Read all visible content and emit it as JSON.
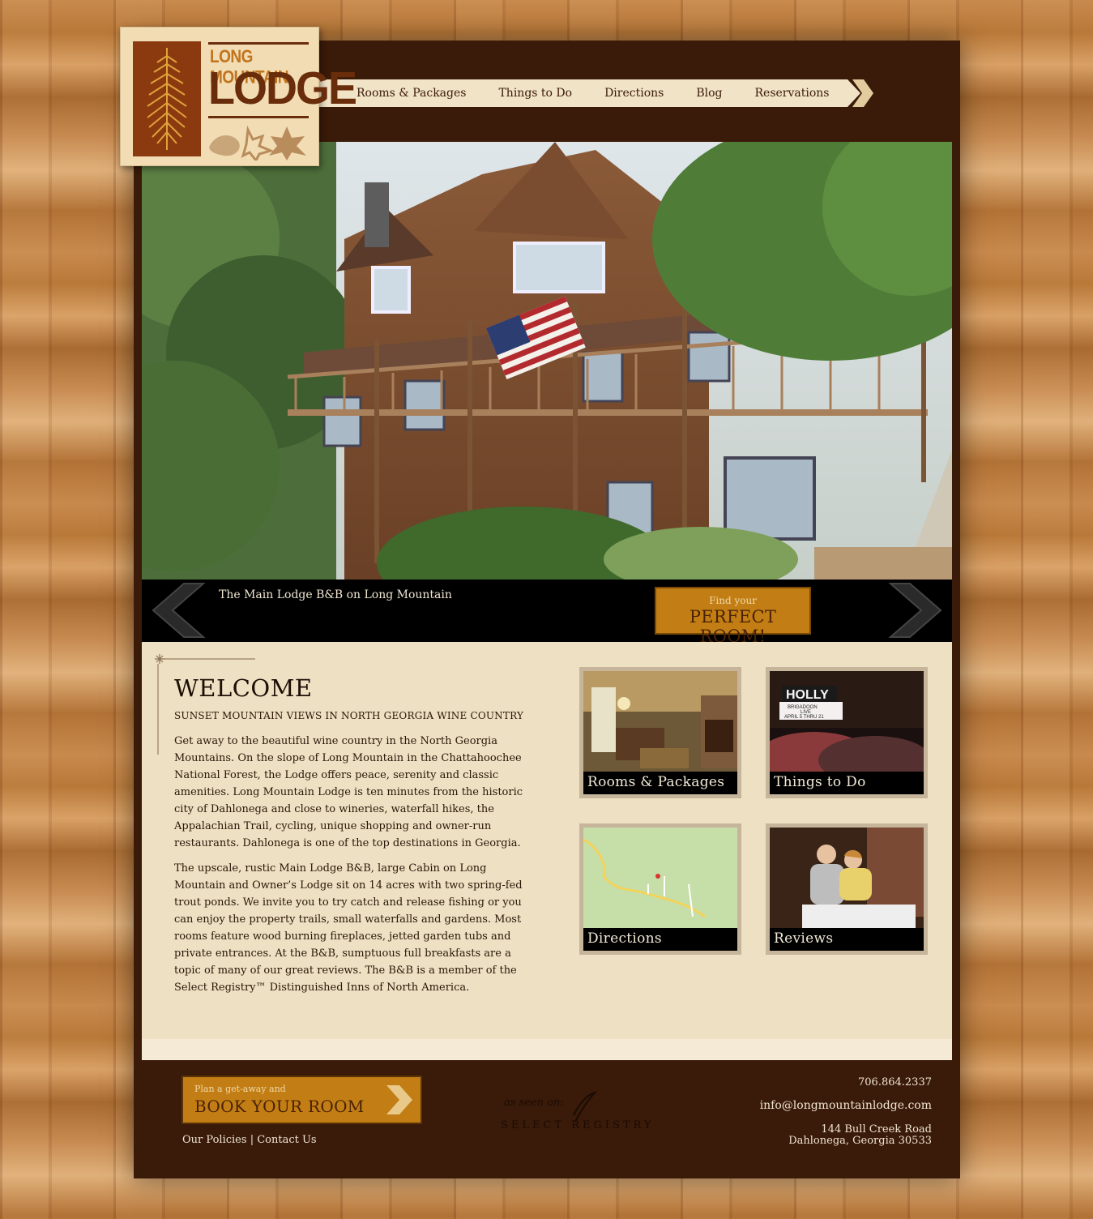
{
  "logo": {
    "line1": "LONG MOUNTAIN",
    "line2": "LODGE"
  },
  "nav": {
    "items": [
      {
        "label": "Rooms & Packages"
      },
      {
        "label": "Things to Do"
      },
      {
        "label": "Directions"
      },
      {
        "label": "Blog"
      },
      {
        "label": "Reservations"
      }
    ]
  },
  "hero": {
    "caption": "The Main Lodge B&B on Long Mountain",
    "find_small": "Find your",
    "find_big": "PERFECT ROOM!"
  },
  "welcome": {
    "title": "WELCOME",
    "subtitle": "SUNSET MOUNTAIN VIEWS IN NORTH GEORGIA WINE COUNTRY",
    "para1": "Get away to the beautiful wine country in the North Georgia Mountains. On the slope of Long Mountain in the Chattahoochee National Forest, the Lodge offers peace, serenity and classic amenities. Long Mountain Lodge is ten minutes from the historic city of Dahlonega and close to wineries, waterfall hikes, the Appalachian Trail, cycling, unique shopping and owner-run restaurants. Dahlonega is one of the top destinations in Georgia.",
    "para2": "The upscale, rustic Main Lodge B&B, large Cabin on Long Mountain and Owner’s Lodge sit on 14 acres with two spring-fed trout ponds. We invite you to try catch and release fishing or you can enjoy the property trails, small waterfalls and gardens. Most rooms feature wood burning fireplaces, jetted garden tubs and private entrances.  At the B&B, sumptuous full breakfasts are a topic of many of our great reviews. The B&B is a member of the Select Registry™ Distinguished Inns of North America."
  },
  "tiles": {
    "rooms": "Rooms & Packages",
    "things": "Things to Do",
    "directions": "Directions",
    "reviews": "Reviews",
    "theater_sign": "HOLLY",
    "theater_marquee1": "BRIGADOON",
    "theater_marquee2": "LIVE",
    "theater_marquee3": "APRIL 5 THRU 21"
  },
  "footer": {
    "book_small": "Plan a get-away and",
    "book_big": "BOOK YOUR ROOM",
    "policies": "Our Policies",
    "separator": "|",
    "contact_us": "Contact Us",
    "seen_on": "as seen on:",
    "select_registry": "SELECT REGISTRY",
    "phone": "706.864.2337",
    "email": "info@longmountainlodge.com",
    "address1": "144 Bull Creek Road",
    "address2": "Dahlonega, Georgia 30533"
  },
  "colors": {
    "page_bg": "#3a1a08",
    "accent": "#c27e14",
    "content_bg": "#ede0c3"
  }
}
